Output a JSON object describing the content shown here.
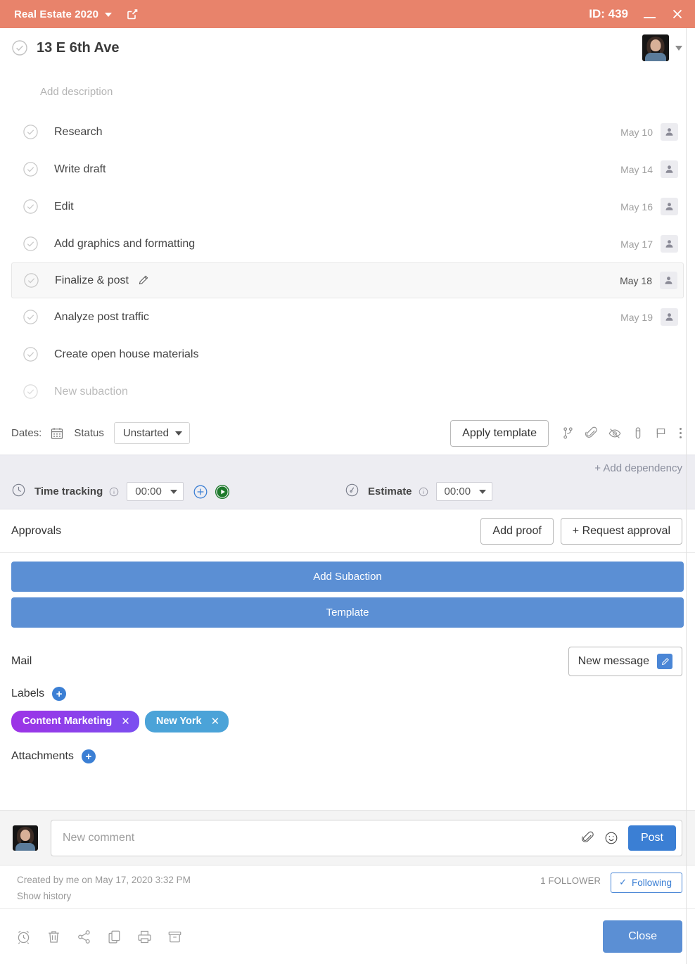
{
  "titlebar": {
    "project": "Real Estate 2020",
    "popout_icon": "external-link-icon",
    "id_label": "ID: 439",
    "minimize_icon": "minimize-icon",
    "close_icon": "close-icon",
    "background_color": "#e8836b"
  },
  "header": {
    "complete_icon": "check-circle-icon",
    "title": "13 E 6th Ave",
    "avatar": "user-avatar",
    "avatar_caret": "chevron-down-icon"
  },
  "description": {
    "placeholder": "Add description"
  },
  "subtasks": [
    {
      "label": "Research",
      "date": "May 10",
      "active": false,
      "assignee_icon": "person-icon"
    },
    {
      "label": "Write draft",
      "date": "May 14",
      "active": false,
      "assignee_icon": "person-icon"
    },
    {
      "label": "Edit",
      "date": "May 16",
      "active": false,
      "assignee_icon": "person-icon"
    },
    {
      "label": "Add graphics and formatting",
      "date": "May 17",
      "active": false,
      "assignee_icon": "person-icon"
    },
    {
      "label": "Finalize & post",
      "date": "May 18",
      "active": true,
      "assignee_icon": "person-icon"
    },
    {
      "label": "Analyze post traffic",
      "date": "May 19",
      "active": false,
      "assignee_icon": "person-icon"
    },
    {
      "label": "Create open house materials",
      "date": "",
      "active": false,
      "assignee_icon": ""
    },
    {
      "label": "New subaction",
      "date": "",
      "active": false,
      "assignee_icon": "",
      "placeholder": true
    }
  ],
  "meta": {
    "dates_label": "Dates:",
    "calendar_icon": "calendar-icon",
    "status_label": "Status",
    "status_value": "Unstarted",
    "apply_template": "Apply template",
    "icons": [
      "dependency-branch-icon",
      "paperclip-icon",
      "eye-off-icon",
      "priority-thermometer-icon",
      "flag-icon",
      "more-vertical-icon"
    ]
  },
  "tracking": {
    "add_dependency": "+ Add dependency",
    "time_tracking_label": "Time tracking",
    "time_tracking_icon": "clock-icon",
    "time_tracking_info": "info-icon",
    "time_value": "00:00",
    "add_time_icon": "plus-circle-icon",
    "start_timer_icon": "play-circle-icon",
    "estimate_label": "Estimate",
    "estimate_icon": "gauge-icon",
    "estimate_info": "info-icon",
    "estimate_value": "00:00",
    "background_color": "#ededf2"
  },
  "approvals": {
    "label": "Approvals",
    "add_proof": "Add proof",
    "request_approval": "+ Request approval"
  },
  "actions": {
    "add_subaction": "Add Subaction",
    "template": "Template",
    "button_color": "#5b8fd4"
  },
  "mail": {
    "label": "Mail",
    "new_message": "New message",
    "pencil_icon": "pencil-icon"
  },
  "labels": {
    "heading": "Labels",
    "add_icon": "plus-circle-icon",
    "chips": [
      {
        "text": "Content Marketing",
        "color": "#9338e0",
        "remove_icon": "close-icon"
      },
      {
        "text": "New York",
        "color": "#4ba3d8",
        "remove_icon": "close-icon"
      }
    ]
  },
  "attachments": {
    "heading": "Attachments",
    "add_icon": "plus-circle-icon"
  },
  "comment": {
    "avatar": "user-avatar",
    "placeholder": "New comment",
    "attach_icon": "paperclip-icon",
    "emoji_icon": "smiley-icon",
    "post_label": "Post",
    "post_color": "#3b7fd4"
  },
  "footer": {
    "created_by": "Created by me on May 17, 2020 3:32 PM",
    "show_history": "Show history",
    "followers": "1 FOLLOWER",
    "following_label": "Following",
    "following_tick": "check-icon"
  },
  "bottom_toolbar": {
    "icons": [
      "alarm-clock-icon",
      "trash-icon",
      "share-icon",
      "duplicate-icon",
      "print-icon",
      "archive-icon"
    ],
    "close_label": "Close",
    "close_color": "#5b8fd4"
  }
}
